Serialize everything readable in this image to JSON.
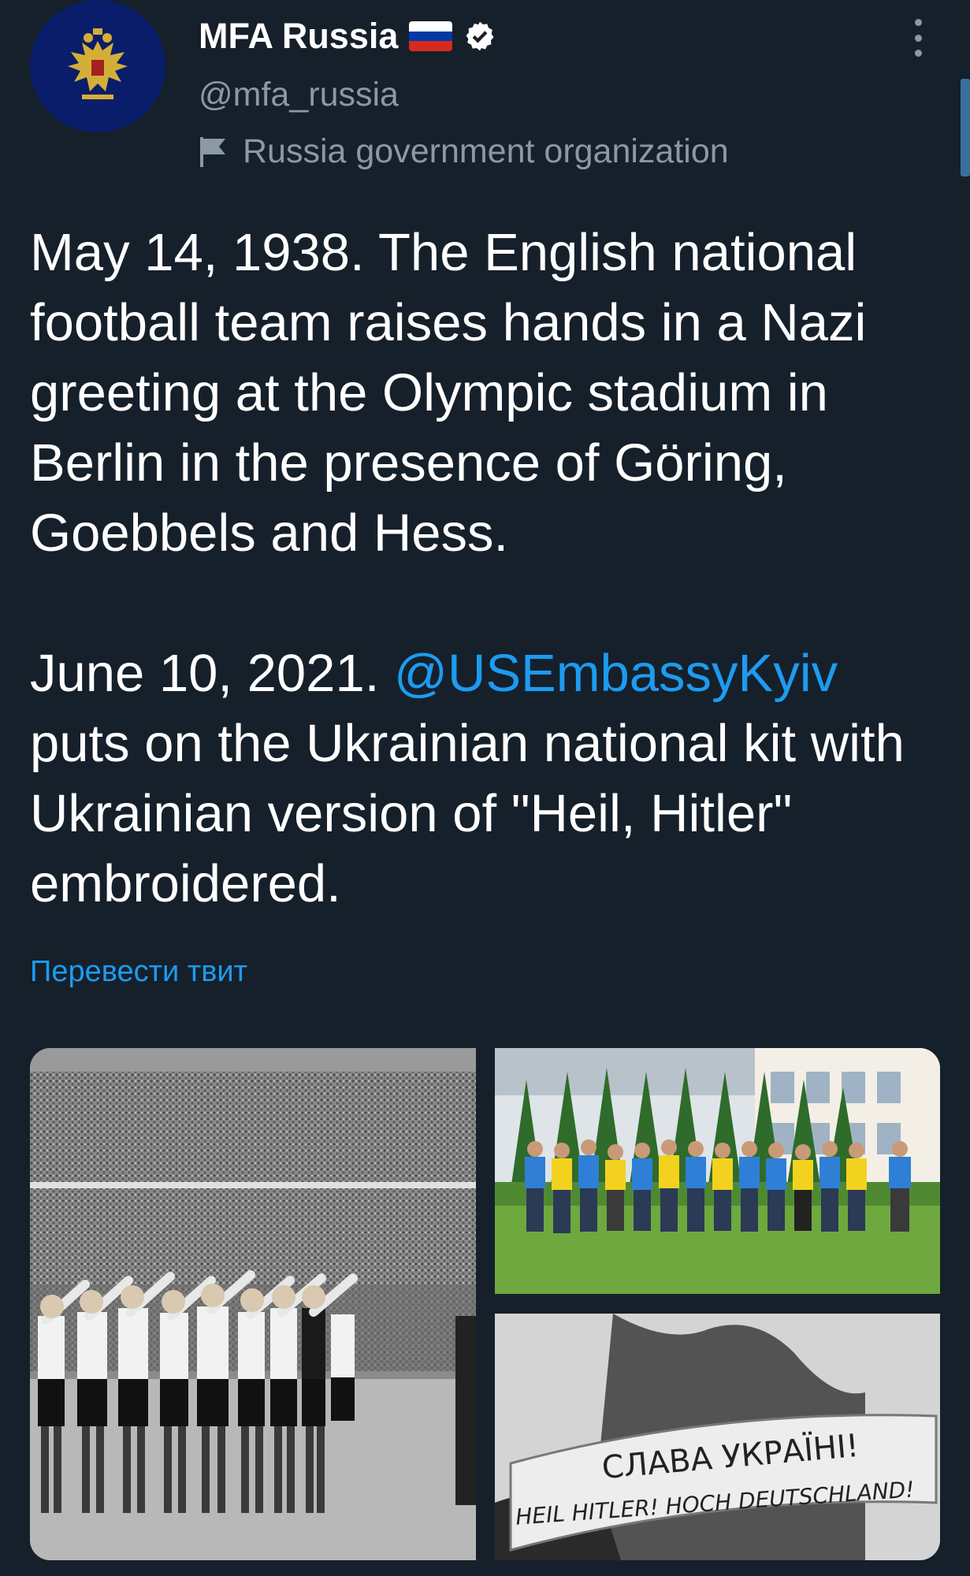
{
  "account": {
    "display_name": "MFA Russia",
    "handle": "@mfa_russia",
    "label": "Russia government organization",
    "verified": true,
    "avatar_icon": "double-headed-eagle-emblem",
    "flag_colors": [
      "#ffffff",
      "#0039a6",
      "#d52b1e"
    ]
  },
  "tweet": {
    "paragraph1": "May 14, 1938. The English national football team raises hands in a Nazi greeting at the Olympic stadium in Berlin in the presence of Göring, Goebbels and Hess.",
    "paragraph2_before": "June 10, 2021. ",
    "mention": "@USEmbassyKyiv",
    "paragraph2_after": " puts on the Ukrainian national kit with Ukrainian version of \"Heil, Hitler\" embroidered.",
    "translate_link": "Перевести твит"
  },
  "media": {
    "banner_line1": "СЛАВА УКРАЇНІ!",
    "banner_line2": "HEIL HITLER! HOCH DEUTSCHLAND!"
  },
  "colors": {
    "background": "#15202b",
    "text": "#ffffff",
    "secondary_text": "#8b98a5",
    "accent": "#1d9bf0"
  }
}
